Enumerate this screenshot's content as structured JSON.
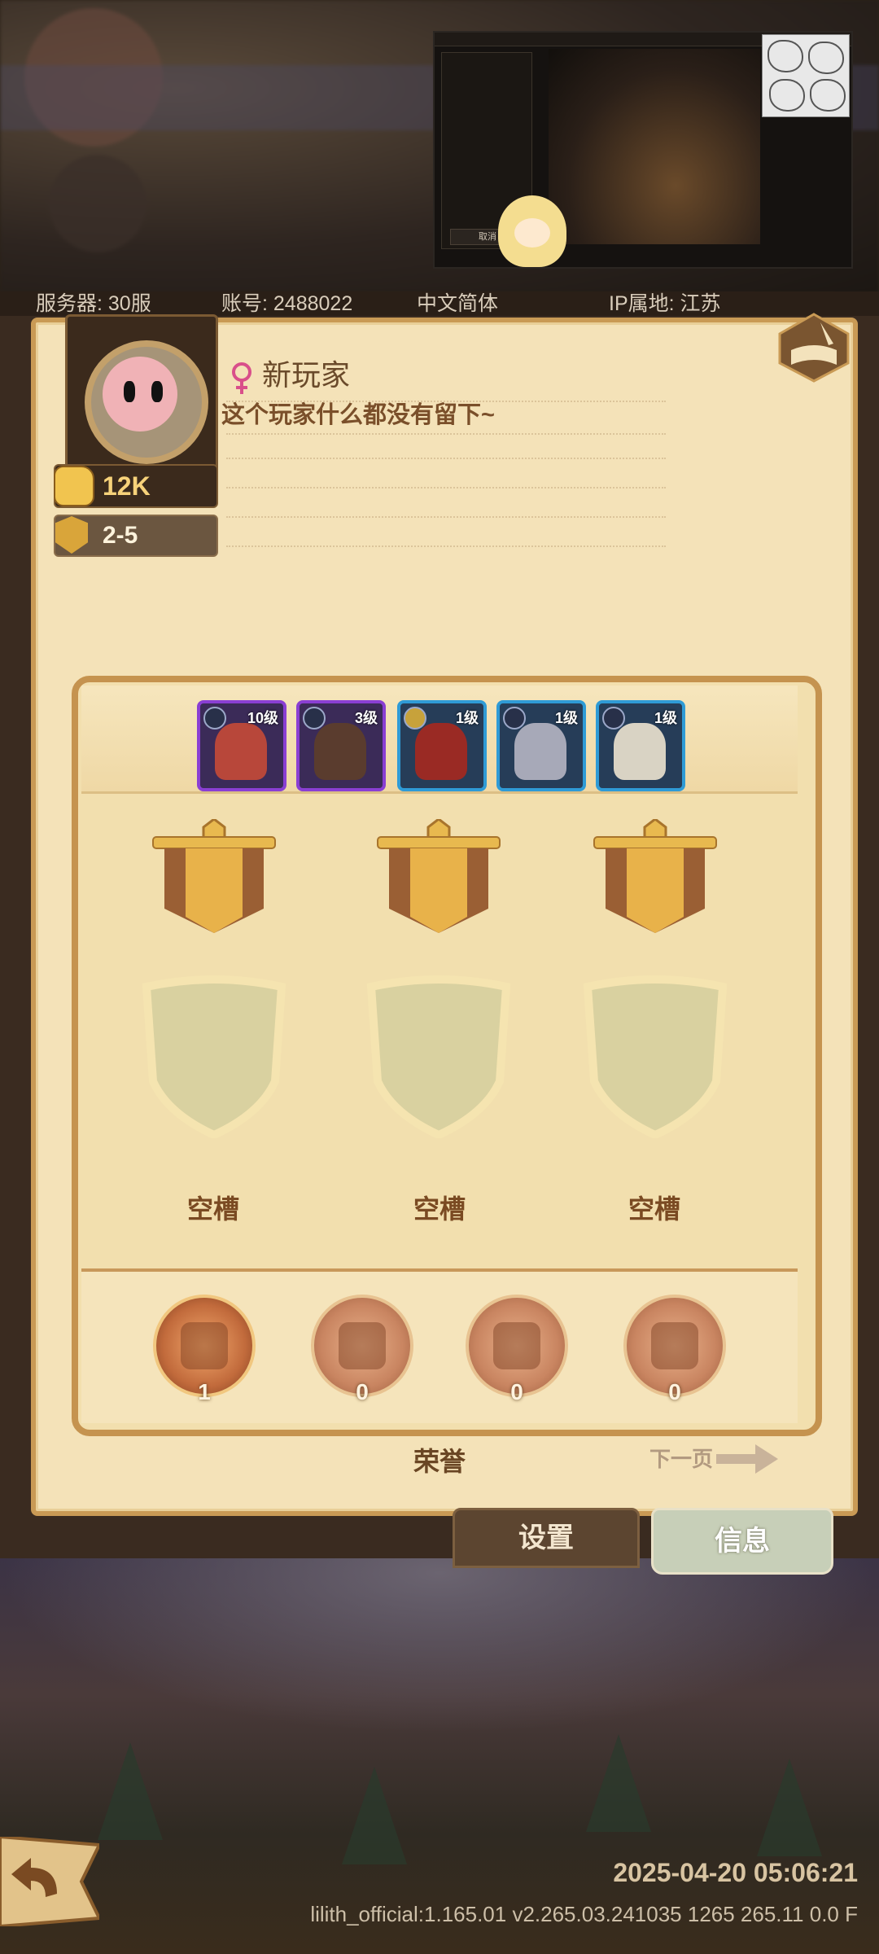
{
  "stream_overlay": {
    "buttons": [
      "取消"
    ]
  },
  "info_bar": {
    "server": "服务器: 30服",
    "account": "账号: 2488022",
    "language": "中文简体",
    "ip_location": "IP属地: 江苏"
  },
  "profile": {
    "name": "新玩家",
    "signature": "这个玩家什么都没有留下~",
    "power": "12K",
    "stage": "2-5",
    "gender_icon": "female-icon"
  },
  "heroes": [
    {
      "level": "10级",
      "rarity": "purple"
    },
    {
      "level": "3级",
      "rarity": "purple"
    },
    {
      "level": "1级",
      "rarity": "blue"
    },
    {
      "level": "1级",
      "rarity": "blue"
    },
    {
      "level": "1级",
      "rarity": "blue"
    }
  ],
  "medal_slots": [
    {
      "label": "空槽"
    },
    {
      "label": "空槽"
    },
    {
      "label": "空槽"
    }
  ],
  "honors": [
    {
      "icon": "star-honor-icon",
      "count": "1"
    },
    {
      "icon": "crown-honor-icon",
      "count": "0"
    },
    {
      "icon": "shell-honor-icon",
      "count": "0"
    },
    {
      "icon": "door-honor-icon",
      "count": "0"
    }
  ],
  "honor_section": {
    "title": "荣誉",
    "next_page": "下一页"
  },
  "tabs": {
    "settings": "设置",
    "info": "信息"
  },
  "footer": {
    "timestamp": "2025-04-20 05:06:21",
    "version": "lilith_official:1.165.01 v2.265.03.241035 1265 265.11 0.0 F"
  },
  "colors": {
    "panel_bg": "#f4e2b8",
    "frame": "#c99a55",
    "purple_rarity": "#8a3fd3",
    "blue_rarity": "#2f9bd6"
  }
}
